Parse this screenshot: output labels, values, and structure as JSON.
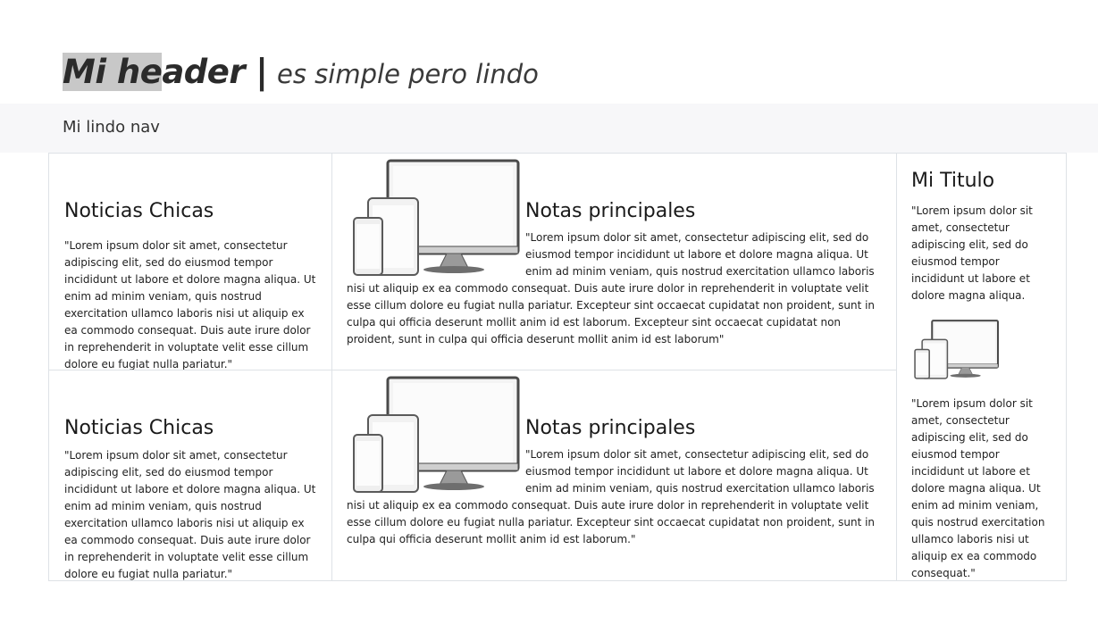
{
  "header": {
    "title_highlight": "Mi he",
    "title_rest": "ader",
    "separator": "|",
    "subtitle": "es simple pero lindo"
  },
  "nav": {
    "label": "Mi lindo nav"
  },
  "rows": [
    {
      "small_title": "Noticias Chicas",
      "small_text": "\"Lorem ipsum dolor sit amet, consectetur adipiscing elit, sed do eiusmod tempor incididunt ut labore et dolore magna aliqua. Ut enim ad minim veniam, quis nostrud exercitation ullamco laboris nisi ut aliquip ex ea commodo consequat. Duis aute irure dolor in reprehenderit in voluptate velit esse cillum dolore eu fugiat nulla pariatur.\"",
      "main_title": "Notas principales",
      "main_text": "\"Lorem ipsum dolor sit amet, consectetur adipiscing elit, sed do eiusmod tempor incididunt ut labore et dolore magna aliqua. Ut enim ad minim veniam, quis nostrud exercitation ullamco laboris nisi ut aliquip ex ea commodo consequat. Duis aute irure dolor in reprehenderit in voluptate velit esse cillum dolore eu fugiat nulla pariatur. Excepteur sint occaecat cupidatat non proident, sunt in culpa qui officia deserunt mollit anim id est laborum. Excepteur sint occaecat cupidatat non proident, sunt in culpa qui officia deserunt mollit anim id est laborum\""
    },
    {
      "small_title": "Noticias Chicas",
      "small_text": "\"Lorem ipsum dolor sit amet, consectetur adipiscing elit, sed do eiusmod tempor incididunt ut labore et dolore magna aliqua. Ut enim ad minim veniam, quis nostrud exercitation ullamco laboris nisi ut aliquip ex ea commodo consequat. Duis aute irure dolor in reprehenderit in voluptate velit esse cillum dolore eu fugiat nulla pariatur.\"",
      "main_title": "Notas principales",
      "main_text": "\"Lorem ipsum dolor sit amet, consectetur adipiscing elit, sed do eiusmod tempor incididunt ut labore et dolore magna aliqua. Ut enim ad minim veniam, quis nostrud exercitation ullamco laboris nisi ut aliquip ex ea commodo consequat. Duis aute irure dolor in reprehenderit in voluptate velit esse cillum dolore eu fugiat nulla pariatur. Excepteur sint occaecat cupidatat non proident, sunt in culpa qui officia deserunt mollit anim id est laborum.\""
    }
  ],
  "sidebar": {
    "title": "Mi Titulo",
    "text_top": "\"Lorem ipsum dolor sit amet, consectetur adipiscing elit, sed do eiusmod tempor incididunt ut labore et dolore magna aliqua.",
    "text_bottom": "\"Lorem ipsum dolor sit amet, consectetur adipiscing elit, sed do eiusmod tempor incididunt ut labore et dolore magna aliqua. Ut enim ad minim veniam, quis nostrud exercitation ullamco laboris nisi ut aliquip ex ea commodo consequat.\""
  },
  "icons": {
    "devices_image": "devices-illustration-icon"
  },
  "colors": {
    "nav_bg": "#f7f7f9",
    "border": "#dee2e6",
    "highlight": "#c8c8c8"
  }
}
